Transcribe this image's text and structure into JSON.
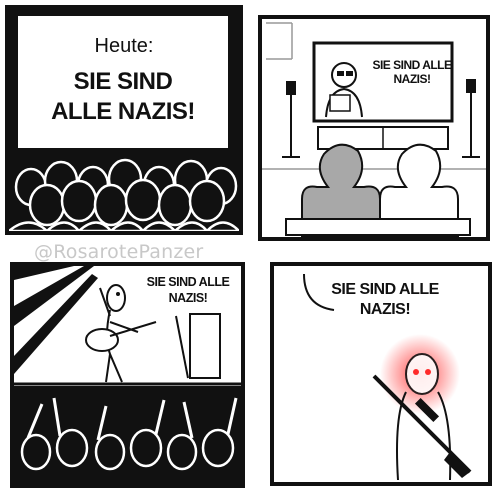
{
  "panel1": {
    "heute": "Heute:",
    "headline": "SIE SIND ALLE NAZIS!"
  },
  "panel2": {
    "tv_text": "SIE SIND ALLE NAZIS!"
  },
  "panel3": {
    "speech": "SIE SIND ALLE NAZIS!"
  },
  "panel4": {
    "speech": "SIE SIND ALLE NAZIS!"
  },
  "watermark": "@RosarotePanzer",
  "colors": {
    "ink": "#111111",
    "gray_head": "#a8a8a8",
    "laser_red": "#ff2a2a"
  }
}
